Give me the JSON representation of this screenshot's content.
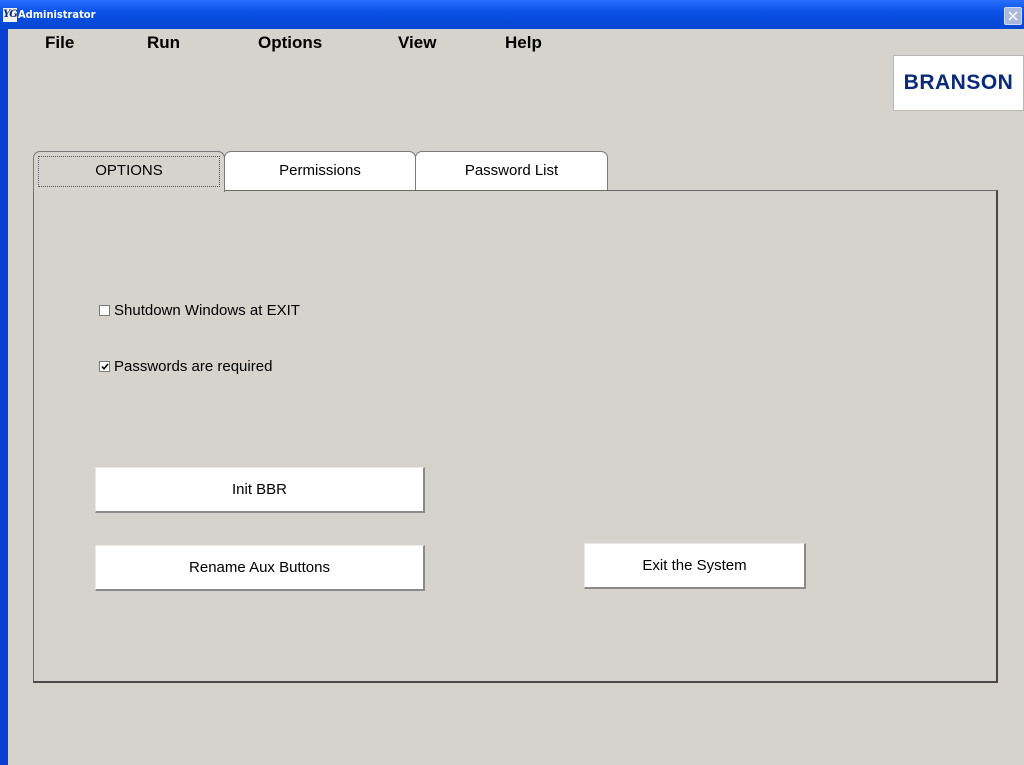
{
  "window": {
    "title": "Administrator",
    "icon_glyph": "YG",
    "icon_name": "app-icon",
    "close_icon": "close-icon"
  },
  "menu": {
    "items": [
      "File",
      "Run",
      "Options",
      "View",
      "Help"
    ]
  },
  "logo": {
    "text": "BRANSON"
  },
  "tabs": [
    {
      "label": "OPTIONS",
      "active": true
    },
    {
      "label": "Permissions",
      "active": false
    },
    {
      "label": "Password List",
      "active": false
    }
  ],
  "options": {
    "shutdown_label": "Shutdown Windows at EXIT",
    "shutdown_checked": false,
    "passwords_label": "Passwords are required",
    "passwords_checked": true
  },
  "buttons": {
    "init_bbr": "Init BBR",
    "rename_aux": "Rename Aux Buttons",
    "exit_system": "Exit the System"
  },
  "colors": {
    "titlebar": "#0a52e6",
    "window_bg": "#d6d2cc",
    "logo_text": "#0a2a7a"
  }
}
